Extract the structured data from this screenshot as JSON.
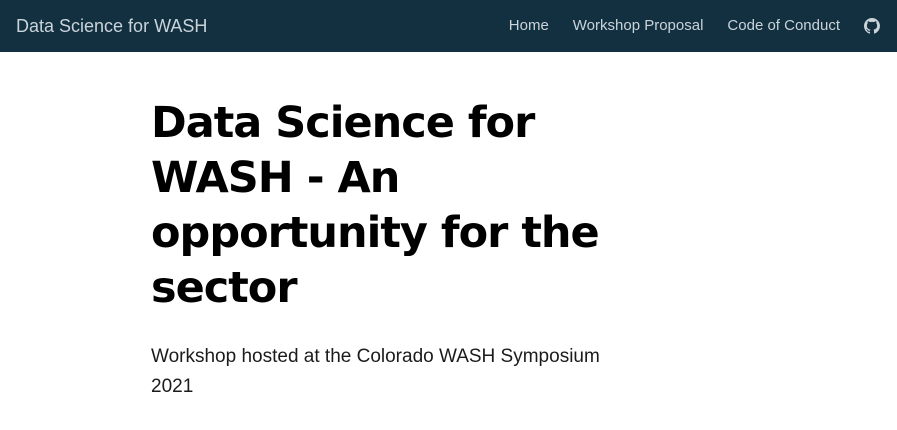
{
  "navbar": {
    "brand": "Data Science for WASH",
    "links": [
      {
        "label": "Home"
      },
      {
        "label": "Workshop Proposal"
      },
      {
        "label": "Code of Conduct"
      }
    ],
    "github_icon": "github-icon",
    "background_color": "#133040",
    "text_color": "#c9d3da"
  },
  "main": {
    "title": "Data Science for WASH - An opportunity for the sector",
    "subtitle": "Workshop hosted at the Colorado WASH Symposium 2021"
  }
}
